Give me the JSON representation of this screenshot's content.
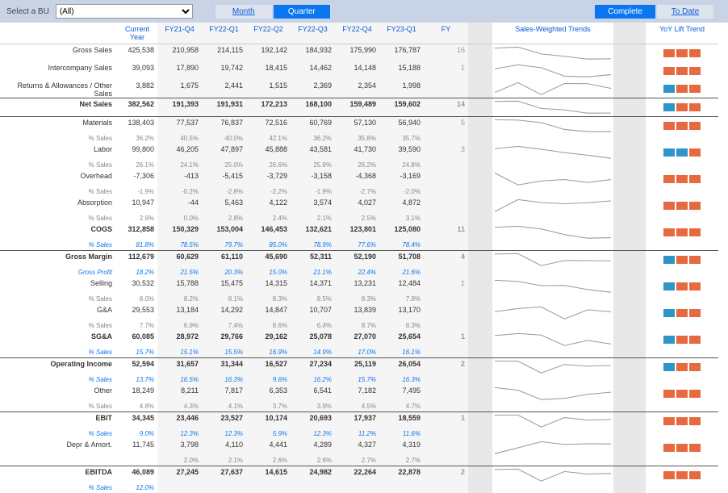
{
  "topbar": {
    "select_label": "Select a BU",
    "select_value": "(All)",
    "month": "Month",
    "quarter": "Quarter",
    "complete": "Complete",
    "todate": "To Date"
  },
  "headers": {
    "current": "Current Year",
    "q": [
      "FY21-Q4",
      "FY22-Q1",
      "FY22-Q2",
      "FY22-Q3",
      "FY22-Q4",
      "FY23-Q1",
      "FY"
    ],
    "swt": "Sales-Weighted Trends",
    "yoy": "YoY Lift Trend"
  },
  "rows": [
    {
      "label": "Gross Sales",
      "cur": "425,538",
      "q": [
        "210,958",
        "214,115",
        "192,142",
        "184,932",
        "175,990",
        "176,787",
        "16"
      ],
      "yoy": [
        -1,
        -1,
        -1
      ]
    },
    {
      "label": "Intercompany Sales",
      "cur": "39,093",
      "q": [
        "17,890",
        "19,742",
        "18,415",
        "14,462",
        "14,148",
        "15,188",
        "1"
      ],
      "yoy": [
        -1,
        -1,
        -1
      ]
    },
    {
      "label": "Returns & Allowances / Other Sales",
      "cur": "3,882",
      "q": [
        "1,675",
        "2,441",
        "1,515",
        "2,369",
        "2,354",
        "1,998",
        ""
      ],
      "yoy": [
        1,
        -1,
        -1
      ]
    },
    {
      "sep": true
    },
    {
      "label": "Net Sales",
      "bold": true,
      "cur": "382,562",
      "q": [
        "191,393",
        "191,931",
        "172,213",
        "168,100",
        "159,489",
        "159,602",
        "14"
      ],
      "yoy": [
        1,
        -1,
        -1
      ]
    },
    {
      "sep": true
    },
    {
      "label": "Materials",
      "sub": "% Sales",
      "cur": "138,403",
      "cursub": "36.2%",
      "q": [
        "77,537",
        "76,837",
        "72,516",
        "60,769",
        "57,130",
        "56,940",
        "5"
      ],
      "qsub": [
        "40.5%",
        "40.0%",
        "42.1%",
        "36.2%",
        "35.8%",
        "35.7%",
        ""
      ],
      "yoy": [
        -1,
        -1,
        -1
      ]
    },
    {
      "label": "Labor",
      "sub": "% Sales",
      "cur": "99,800",
      "cursub": "26.1%",
      "q": [
        "46,205",
        "47,897",
        "45,888",
        "43,581",
        "41,730",
        "39,590",
        "3"
      ],
      "qsub": [
        "24.1%",
        "25.0%",
        "26.6%",
        "25.9%",
        "26.2%",
        "24.8%",
        ""
      ],
      "yoy": [
        1,
        1,
        -1
      ]
    },
    {
      "label": "Overhead",
      "sub": "% Sales",
      "cur": "-7,306",
      "cursub": "-1.9%",
      "q": [
        "-413",
        "-5,415",
        "-3,729",
        "-3,158",
        "-4,368",
        "-3,169",
        ""
      ],
      "qsub": [
        "-0.2%",
        "-2.8%",
        "-2.2%",
        "-1.9%",
        "-2.7%",
        "-2.0%",
        ""
      ],
      "yoy": [
        -1,
        -1,
        -1
      ]
    },
    {
      "label": "Absorption",
      "sub": "% Sales",
      "cur": "10,947",
      "cursub": "2.9%",
      "q": [
        "-44",
        "5,463",
        "4,122",
        "3,574",
        "4,027",
        "4,872",
        ""
      ],
      "qsub": [
        "0.0%",
        "2.8%",
        "2.4%",
        "2.1%",
        "2.5%",
        "3.1%",
        ""
      ],
      "yoy": [
        -1,
        -1,
        -1
      ]
    },
    {
      "label": "COGS",
      "bold": true,
      "sub": "% Sales",
      "subblue": true,
      "cur": "312,858",
      "cursub": "81.8%",
      "q": [
        "150,329",
        "153,004",
        "146,453",
        "132,621",
        "123,801",
        "125,080",
        "11"
      ],
      "qsub": [
        "78.5%",
        "79.7%",
        "85.0%",
        "78.9%",
        "77.6%",
        "78.4%",
        ""
      ],
      "yoy": [
        -1,
        -1,
        -1
      ]
    },
    {
      "sep": true
    },
    {
      "label": "Gross Margin",
      "bold": true,
      "sub": "Gross Profit",
      "subblue": true,
      "cur": "112,679",
      "cursub": "18.2%",
      "q": [
        "60,629",
        "61,110",
        "45,690",
        "52,311",
        "52,190",
        "51,708",
        "4"
      ],
      "qsub": [
        "21.5%",
        "20.3%",
        "15.0%",
        "21.1%",
        "22.4%",
        "21.6%",
        ""
      ],
      "yoy": [
        1,
        -1,
        -1
      ]
    },
    {
      "label": "Selling",
      "sub": "% Sales",
      "cur": "30,532",
      "cursub": "8.0%",
      "q": [
        "15,788",
        "15,475",
        "14,315",
        "14,371",
        "13,231",
        "12,484",
        "1"
      ],
      "qsub": [
        "8.2%",
        "8.1%",
        "8.3%",
        "8.5%",
        "8.3%",
        "7.8%",
        ""
      ],
      "yoy": [
        1,
        -1,
        -1
      ]
    },
    {
      "label": "G&A",
      "sub": "% Sales",
      "cur": "29,553",
      "cursub": "7.7%",
      "q": [
        "13,184",
        "14,292",
        "14,847",
        "10,707",
        "13,839",
        "13,170",
        ""
      ],
      "qsub": [
        "6.9%",
        "7.4%",
        "8.6%",
        "6.4%",
        "8.7%",
        "8.3%",
        ""
      ],
      "yoy": [
        1,
        -1,
        -1
      ]
    },
    {
      "label": "SG&A",
      "bold": true,
      "sub": "% Sales",
      "subblue": true,
      "cur": "60,085",
      "cursub": "15.7%",
      "q": [
        "28,972",
        "29,766",
        "29,162",
        "25,078",
        "27,070",
        "25,654",
        "1"
      ],
      "qsub": [
        "15.1%",
        "15.5%",
        "16.9%",
        "14.9%",
        "17.0%",
        "16.1%",
        ""
      ],
      "yoy": [
        1,
        -1,
        -1
      ]
    },
    {
      "sep": true
    },
    {
      "label": "Operating Income",
      "bold": true,
      "sub": "% Sales",
      "subblue": true,
      "cur": "52,594",
      "cursub": "13.7%",
      "q": [
        "31,657",
        "31,344",
        "16,527",
        "27,234",
        "25,119",
        "26,054",
        "2"
      ],
      "qsub": [
        "16.5%",
        "16.3%",
        "9.6%",
        "16.2%",
        "15.7%",
        "16.3%",
        ""
      ],
      "yoy": [
        1,
        -1,
        -1
      ]
    },
    {
      "label": "Other",
      "sub": "% Sales",
      "cur": "18,249",
      "cursub": "4.8%",
      "q": [
        "8,211",
        "7,817",
        "6,353",
        "6,541",
        "7,182",
        "7,495",
        ""
      ],
      "qsub": [
        "4.3%",
        "4.1%",
        "3.7%",
        "3.9%",
        "4.5%",
        "4.7%",
        ""
      ],
      "yoy": [
        -1,
        -1,
        -1
      ]
    },
    {
      "sep": true
    },
    {
      "label": "EBIT",
      "bold": true,
      "sub": "% Sales",
      "subblue": true,
      "cur": "34,345",
      "cursub": "9.0%",
      "q": [
        "23,446",
        "23,527",
        "10,174",
        "20,693",
        "17,937",
        "18,559",
        "1"
      ],
      "qsub": [
        "12.3%",
        "12.3%",
        "5.9%",
        "12.3%",
        "11.2%",
        "11.6%",
        ""
      ],
      "yoy": [
        -1,
        -1,
        -1
      ]
    },
    {
      "label": "Depr & Amort.",
      "cur": "11,745",
      "q": [
        "3,798",
        "4,110",
        "4,441",
        "4,289",
        "4,327",
        "4,319",
        ""
      ],
      "qsub": [
        "2.0%",
        "2.1%",
        "2.6%",
        "2.6%",
        "2.7%",
        "2.7%",
        ""
      ],
      "yoy": [
        -1,
        -1,
        -1
      ]
    },
    {
      "sep": true
    },
    {
      "label": "EBITDA",
      "bold": true,
      "sub": "% Sales",
      "subblue": true,
      "cur": "46,089",
      "cursub": "12.0%",
      "q": [
        "27,245",
        "27,637",
        "14,615",
        "24,982",
        "22,264",
        "22,878",
        "2"
      ],
      "qsub": [
        "",
        "",
        "",
        "",
        "",
        "",
        ""
      ],
      "yoy": [
        -1,
        -1,
        -1
      ]
    }
  ],
  "chart_data": {
    "type": "table",
    "title": "P&L by Quarter",
    "periods": [
      "FY21-Q4",
      "FY22-Q1",
      "FY22-Q2",
      "FY22-Q3",
      "FY22-Q4",
      "FY23-Q1"
    ],
    "metrics": {
      "Gross Sales": [
        210958,
        214115,
        192142,
        184932,
        175990,
        176787
      ],
      "Intercompany Sales": [
        17890,
        19742,
        18415,
        14462,
        14148,
        15188
      ],
      "Returns & Allowances / Other Sales": [
        1675,
        2441,
        1515,
        2369,
        2354,
        1998
      ],
      "Net Sales": [
        191393,
        191931,
        172213,
        168100,
        159489,
        159602
      ],
      "Materials": [
        77537,
        76837,
        72516,
        60769,
        57130,
        56940
      ],
      "Labor": [
        46205,
        47897,
        45888,
        43581,
        41730,
        39590
      ],
      "Overhead": [
        -413,
        -5415,
        -3729,
        -3158,
        -4368,
        -3169
      ],
      "Absorption": [
        -44,
        5463,
        4122,
        3574,
        4027,
        4872
      ],
      "COGS": [
        150329,
        153004,
        146453,
        132621,
        123801,
        125080
      ],
      "Gross Margin": [
        60629,
        61110,
        45690,
        52311,
        52190,
        51708
      ],
      "Selling": [
        15788,
        15475,
        14315,
        14371,
        13231,
        12484
      ],
      "G&A": [
        13184,
        14292,
        14847,
        10707,
        13839,
        13170
      ],
      "SG&A": [
        28972,
        29766,
        29162,
        25078,
        27070,
        25654
      ],
      "Operating Income": [
        31657,
        31344,
        16527,
        27234,
        25119,
        26054
      ],
      "Other": [
        8211,
        7817,
        6353,
        6541,
        7182,
        7495
      ],
      "EBIT": [
        23446,
        23527,
        10174,
        20693,
        17937,
        18559
      ],
      "Depr & Amort.": [
        3798,
        4110,
        4441,
        4289,
        4327,
        4319
      ],
      "EBITDA": [
        27245,
        27637,
        14615,
        24982,
        22264,
        22878
      ]
    },
    "current_year": {
      "Gross Sales": 425538,
      "Intercompany Sales": 39093,
      "Returns & Allowances / Other Sales": 3882,
      "Net Sales": 382562,
      "Materials": 138403,
      "Labor": 99800,
      "Overhead": -7306,
      "Absorption": 10947,
      "COGS": 312858,
      "Gross Margin": 112679,
      "Selling": 30532,
      "G&A": 29553,
      "SG&A": 60085,
      "Operating Income": 52594,
      "Other": 18249,
      "EBIT": 34345,
      "Depr & Amort.": 11745,
      "EBITDA": 46089
    }
  }
}
